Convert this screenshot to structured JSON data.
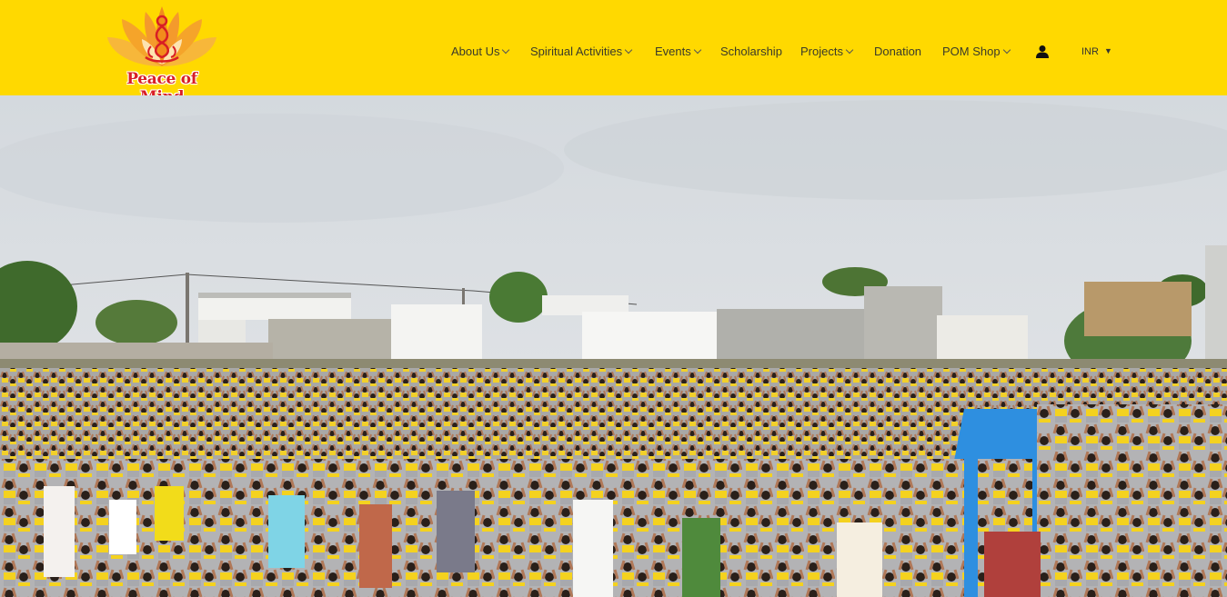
{
  "brand": {
    "name": "Peace of Mind",
    "colors": {
      "header_bg": "#ffd900",
      "logo_red": "#d81e25",
      "logo_orange": "#f28c1c"
    }
  },
  "nav": {
    "items": [
      {
        "label": "About Us",
        "has_dropdown": true
      },
      {
        "label": "Spiritual Activities",
        "has_dropdown": true
      },
      {
        "label": "Events",
        "has_dropdown": true
      },
      {
        "label": "Scholarship",
        "has_dropdown": false
      },
      {
        "label": "Projects",
        "has_dropdown": true
      },
      {
        "label": "Donation",
        "has_dropdown": false
      },
      {
        "label": "POM Shop",
        "has_dropdown": true
      }
    ],
    "user_icon": "user-icon",
    "currency": {
      "selected": "INR",
      "icon": "caret-down-icon"
    }
  },
  "hero": {
    "image": "photo-of-mass-yoga-session-in-open-field",
    "colors": {
      "sky": "#d9dde2",
      "mat_yellow": "#e6c35a",
      "mat_blue": "#2e8fe0",
      "uniform_yellow": "#f4d21f",
      "uniform_grey": "#a8a9ad"
    }
  }
}
